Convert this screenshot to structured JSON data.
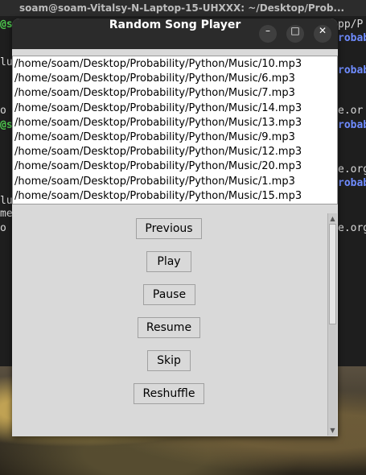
{
  "terminal": {
    "title": "soam@soam-Vitalsy-N-Laptop-15-UHXXX: ~/Desktop/Prob...",
    "frags": [
      "@s",
      "pp/P",
      "robab",
      "lus",
      "robab",
      "o",
      "e.or",
      "@s",
      "robab",
      "e.org",
      "lus",
      "robab",
      "me",
      "o",
      "e.org"
    ]
  },
  "window": {
    "title": "Random Song Player",
    "controls": {
      "minimize": "–",
      "maximize": "□",
      "close": "✕"
    }
  },
  "playlist": [
    "/home/soam/Desktop/Probability/Python/Music/10.mp3",
    "/home/soam/Desktop/Probability/Python/Music/6.mp3",
    "/home/soam/Desktop/Probability/Python/Music/7.mp3",
    "/home/soam/Desktop/Probability/Python/Music/14.mp3",
    "/home/soam/Desktop/Probability/Python/Music/13.mp3",
    "/home/soam/Desktop/Probability/Python/Music/9.mp3",
    "/home/soam/Desktop/Probability/Python/Music/12.mp3",
    "/home/soam/Desktop/Probability/Python/Music/20.mp3",
    "/home/soam/Desktop/Probability/Python/Music/1.mp3",
    "/home/soam/Desktop/Probability/Python/Music/15.mp3"
  ],
  "buttons": {
    "previous": "Previous",
    "play": "Play",
    "pause": "Pause",
    "resume": "Resume",
    "skip": "Skip",
    "reshuffle": "Reshuffle"
  },
  "scrollbar": {
    "up_icon": "triangle-up",
    "down_icon": "triangle-down"
  }
}
